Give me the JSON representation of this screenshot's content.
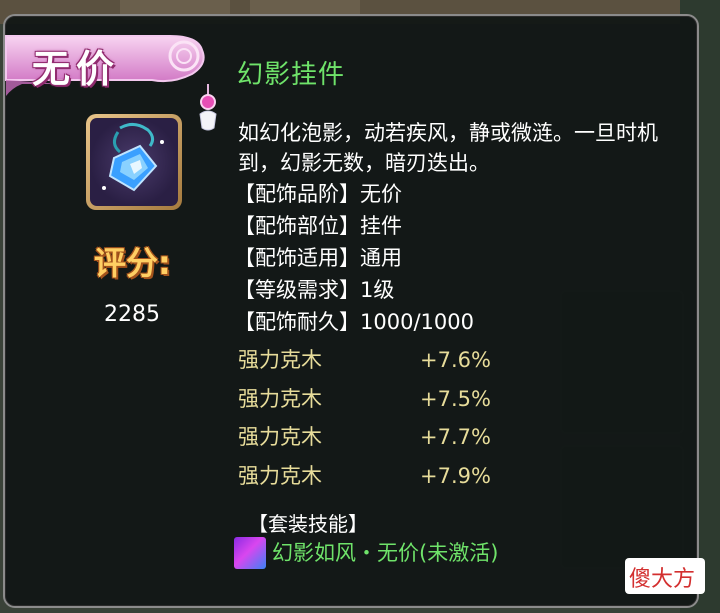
{
  "tooltip": {
    "quality": "无价",
    "item_name": "幻影挂件",
    "description": "如幻化泡影，动若疾风，静或微涟。一旦时机到，幻影无数，暗刃迭出。",
    "score_label": "评分:",
    "score_value": "2285",
    "attributes": [
      {
        "label": "【配饰品阶】无价"
      },
      {
        "label": "【配饰部位】挂件"
      },
      {
        "label": "【配饰适用】通用"
      },
      {
        "label": "【等级需求】1级"
      },
      {
        "label": "【配饰耐久】1000/1000"
      }
    ],
    "bonuses": [
      {
        "name": "强力克木",
        "value": "+7.6%"
      },
      {
        "name": "强力克木",
        "value": "+7.5%"
      },
      {
        "name": "强力克木",
        "value": "+7.7%"
      },
      {
        "name": "强力克木",
        "value": "+7.9%"
      }
    ],
    "set_header": "【套装技能】",
    "set_skill": "幻影如风・无价(未激活)"
  },
  "watermark": "傻大方",
  "colors": {
    "item_name": "#6fe36a",
    "bonus_text": "#e7dc9a",
    "score_label": "#ffcf63",
    "quality_banner": "#e9a3e0"
  },
  "icons": {
    "item": "crystal-pendant-icon",
    "set_skill": "skill-swirl-icon"
  }
}
